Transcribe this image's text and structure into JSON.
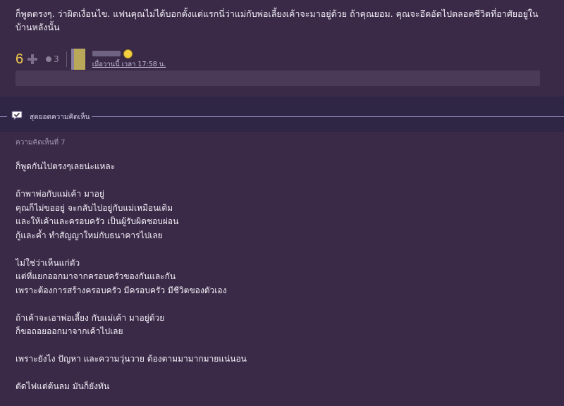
{
  "top_comment": {
    "text": "ก็พูดตรงๆ. ว่าผิดเงื่อนไข. แฟนคุณไม่ได้บอกตั้งแต่แรกนี่ว่าแม่กับพ่อเลี้ยงเค้าจะมาอยู่ด้วย   ถ้าคุณยอม. คุณจะอึดอัดไปตลอดชีวิตที่อาศัยอยู่ในบ้านหลังนั้น",
    "vote_count": "6",
    "emotion_count": "3",
    "post_time": "เมื่อวานนี้ เวลา 17:58 น."
  },
  "best_section": {
    "label": "สุดยอดความคิดเห็น"
  },
  "reply": {
    "comment_number": "ความคิดเห็นที่ 7",
    "lines": [
      "ก็พูดกันไปตรงๆเลยน่ะแหละ",
      "",
      "ถ้าพาพ่อกับแม่เค้า มาอยู่",
      "คุณก็ไม่ขออยู่ จะกลับไปอยู่กับแม่เหมือนเดิม",
      "และให้เค้าและครอบครัว เป็นผู้รับผิดชอบผ่อน",
      "กู้และค้ำ ทำสัญญาใหม่กับธนาคารไปเลย",
      "",
      "ไม่ใช่ว่าเห็นแก่ตัว",
      "แต่ที่แยกออกมาจากครอบครัวของกันและกัน",
      "เพราะต้องการสร้างครอบครัว มีครอบครัว มีชีวิตของตัวเอง",
      "",
      "ถ้าเค้าจะเอาพ่อเลี้ยง กับแม่เค้า มาอยู่ด้วย",
      "ก็ขอถอยออกมาจากเค้าไปเลย",
      "",
      "เพราะยังไง ปัญหา และความวุ่นวาย ต้องตามมามากมายแน่นอน",
      "",
      "ตัดไฟแต่ต้นลม มันก็ยังทัน"
    ]
  },
  "colors": {
    "background": "#3a2a48",
    "best_bar": "#2f2545",
    "vote_color": "#f2c94c"
  }
}
